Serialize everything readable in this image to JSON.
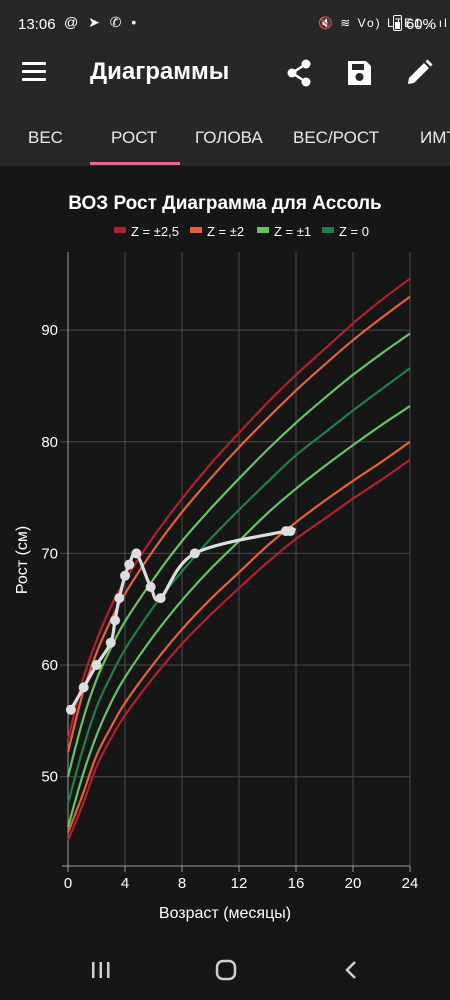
{
  "status_bar": {
    "time": "13:06",
    "left_icons": "@ ➤ ✆ •",
    "right_icons": "🔇 ≋ Vo) LTE1 ..ıl",
    "battery": "60%"
  },
  "app_bar": {
    "title": "Диаграммы",
    "menu_icon": "hamburger-icon",
    "actions": [
      "share-icon",
      "save-icon",
      "edit-icon"
    ]
  },
  "tabs": [
    {
      "label": "ВЕС",
      "selected": false
    },
    {
      "label": "РОСТ",
      "selected": true
    },
    {
      "label": "ГОЛОВА",
      "selected": false
    },
    {
      "label": "ВЕС/РОСТ",
      "selected": false
    },
    {
      "label": "ИМТ",
      "selected": false
    }
  ],
  "colors": {
    "z25": "#b0202e",
    "z2": "#e5603f",
    "z1": "#67c466",
    "z0": "#1e7f47",
    "patient": "#dddddd",
    "accent": "#e26a8a"
  },
  "chart_data": {
    "type": "line",
    "title": "ВОЗ Рост Диаграмма для Ассоль",
    "xlabel": "Возраст (месяцы)",
    "ylabel": "Рост (см)",
    "xlim": [
      0,
      24
    ],
    "ylim": [
      42,
      97
    ],
    "x_ticks": [
      0,
      4,
      8,
      12,
      16,
      20,
      24
    ],
    "y_ticks": [
      50,
      60,
      70,
      80,
      90
    ],
    "grid": true,
    "legend_position": "top",
    "legend": [
      {
        "label": "Z = ±2,5",
        "color": "#b0202e"
      },
      {
        "label": "Z = ±2",
        "color": "#e5603f"
      },
      {
        "label": "Z = ±1",
        "color": "#67c466"
      },
      {
        "label": "Z = 0",
        "color": "#1e7f47"
      }
    ],
    "reference_x": [
      0,
      1,
      2,
      3,
      4,
      6,
      8,
      10,
      12,
      14,
      16,
      18,
      20,
      22,
      24
    ],
    "series": [
      {
        "name": "Z = ±2,5",
        "group": "z25",
        "values": [
          53.3,
          58.5,
          62.2,
          65.2,
          67.6,
          71.5,
          74.9,
          78.0,
          80.8,
          83.5,
          86.0,
          88.3,
          90.6,
          92.7,
          94.6
        ]
      },
      {
        "name": "Z = ±2",
        "group": "z2",
        "values": [
          52.2,
          57.3,
          61.1,
          64.0,
          66.4,
          70.3,
          73.7,
          76.7,
          79.5,
          82.1,
          84.6,
          86.9,
          89.1,
          91.1,
          93.0
        ]
      },
      {
        "name": "Z = ±1",
        "group": "z1",
        "values": [
          50.0,
          54.9,
          58.7,
          61.5,
          63.9,
          67.7,
          71.1,
          74.0,
          76.7,
          79.3,
          81.7,
          83.9,
          86.0,
          87.9,
          89.7
        ]
      },
      {
        "name": "Z = 0",
        "group": "z0",
        "values": [
          47.6,
          52.3,
          56.2,
          59.0,
          61.4,
          65.2,
          68.4,
          71.3,
          73.9,
          76.4,
          78.8,
          80.8,
          82.8,
          84.7,
          86.6
        ]
      },
      {
        "name": "Z = -1",
        "group": "z1",
        "values": [
          45.5,
          50.0,
          53.7,
          56.6,
          58.9,
          62.6,
          65.8,
          68.6,
          71.1,
          73.6,
          75.8,
          77.8,
          79.7,
          81.5,
          83.2
        ]
      },
      {
        "name": "Z = -2",
        "group": "z2",
        "values": [
          45.0,
          48.3,
          51.9,
          54.4,
          56.6,
          60.1,
          63.2,
          65.9,
          68.3,
          70.7,
          72.8,
          74.7,
          76.5,
          78.2,
          80.0
        ]
      },
      {
        "name": "Z = -2,5",
        "group": "z25",
        "values": [
          44.3,
          47.4,
          50.9,
          53.4,
          55.5,
          58.9,
          61.9,
          64.5,
          66.9,
          69.2,
          71.3,
          73.1,
          74.9,
          76.6,
          78.4
        ]
      }
    ],
    "patient": {
      "x": [
        0.2,
        1.1,
        2.0,
        3.0,
        3.3,
        3.6,
        4.0,
        4.3,
        4.8,
        5.8,
        6.5,
        8.9,
        15.3,
        15.6
      ],
      "y": [
        56,
        58,
        60,
        62,
        64,
        66,
        68,
        69,
        70,
        67,
        66,
        70,
        72,
        72
      ]
    }
  }
}
